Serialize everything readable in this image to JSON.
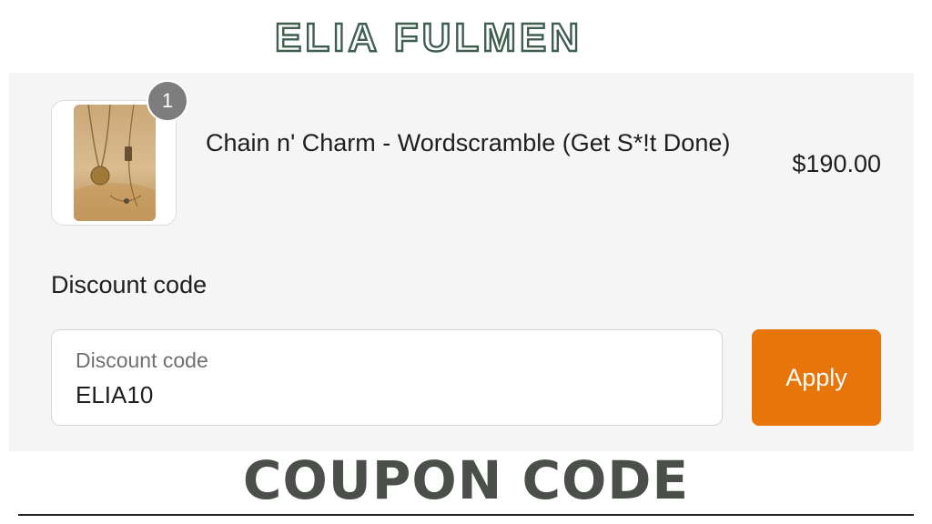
{
  "brand": {
    "name": "ELIA FULMEN",
    "color": "#3f5e4f"
  },
  "cart": {
    "item": {
      "quantity": "1",
      "name": "Chain n' Charm - Wordscramble (Get S*!t Done)",
      "price": "$190.00",
      "image_icon": "necklace-product-photo"
    }
  },
  "discount": {
    "heading": "Discount code",
    "field_label": "Discount code",
    "value": "ELIA10",
    "apply_label": "Apply",
    "accent_color": "#e8750a"
  },
  "caption": {
    "text": "COUPON CODE",
    "color": "#4a4f4a"
  }
}
